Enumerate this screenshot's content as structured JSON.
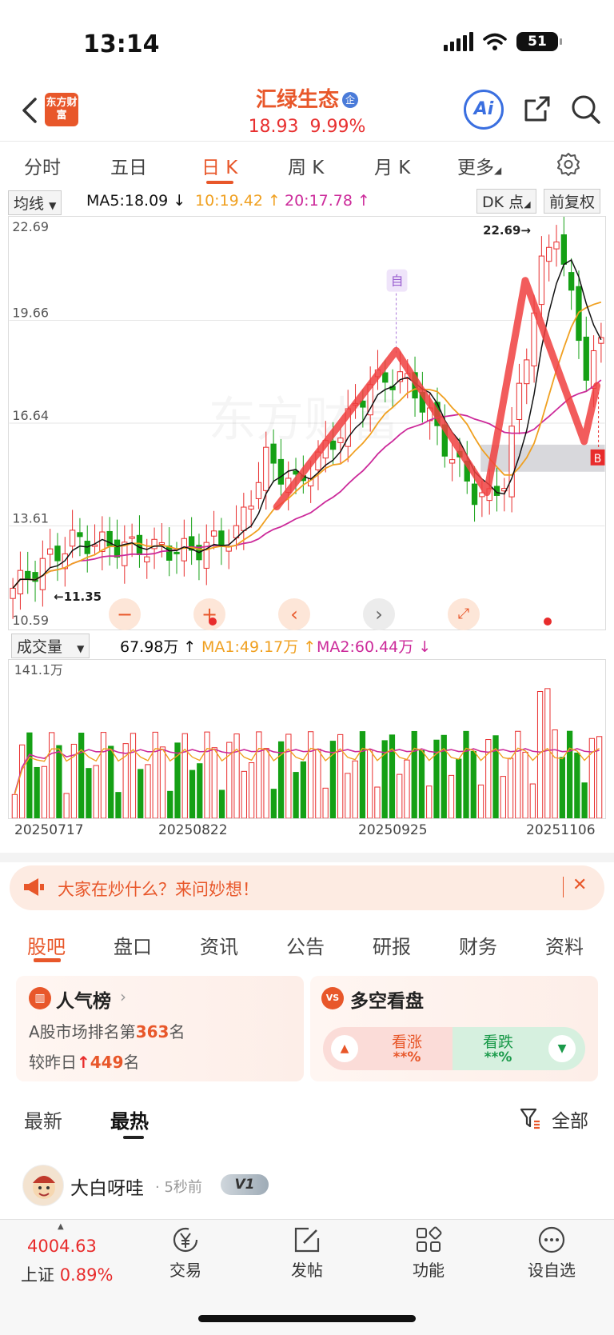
{
  "status": {
    "time": "13:14",
    "battery": "51"
  },
  "header": {
    "logo_text": "东方财富",
    "stock_name": "汇绿生态",
    "badge": "企",
    "price": "18.93",
    "change_pct": "9.99%",
    "ai_label": "Ai"
  },
  "period_tabs": [
    "分时",
    "五日",
    "日 K",
    "周 K",
    "月 K",
    "更多"
  ],
  "indicator": {
    "main_select": "均线",
    "ma5": "MA5:18.09 ↓",
    "ma10": "10:19.42 ↑",
    "ma20": "20:17.78 ↑",
    "dk": "DK 点",
    "adjust": "前复权"
  },
  "price_axis": [
    "22.69",
    "19.66",
    "16.64",
    "13.61",
    "10.59"
  ],
  "annotations": {
    "high": "22.69→",
    "low": "←11.35",
    "self_marker": "自",
    "b_marker": "B"
  },
  "volume": {
    "select": "成交量",
    "value": "67.98万 ↑",
    "ma1": "MA1:49.17万 ↑",
    "ma2": "MA2:60.44万 ↓",
    "axis_max": "141.1万"
  },
  "dates": [
    "20250717",
    "20250822",
    "20250925",
    "20251106"
  ],
  "colors": {
    "up": "#e82c2c",
    "down": "#15a015",
    "ma5": "#111111",
    "ma10": "#f0a020",
    "ma20": "#cc2a9a",
    "accent": "#e8572a"
  },
  "banner": {
    "text": "大家在炒什么？来问妙想！"
  },
  "content_tabs": [
    "股吧",
    "盘口",
    "资讯",
    "公告",
    "研报",
    "财务",
    "资料"
  ],
  "popularity": {
    "title": "人气榜",
    "rank_prefix": "A股市场排名第",
    "rank": "363",
    "rank_suffix": "名",
    "change_prefix": "较昨日",
    "change": "449",
    "change_suffix": "名"
  },
  "sentiment": {
    "title": "多空看盘",
    "icon_text": "VS",
    "rise_label": "看涨",
    "rise_value": "**%",
    "fall_label": "看跌",
    "fall_value": "**%"
  },
  "feed": {
    "tabs": [
      "最新",
      "最热"
    ],
    "filter": "全部",
    "post_user": "大白呀哇",
    "post_time": "· 5秒前",
    "level": "V1"
  },
  "bottom_bar": {
    "index_value": "4004.63",
    "index_name": "上证",
    "index_change": "0.89%",
    "items": [
      "交易",
      "发帖",
      "功能",
      "设自选"
    ]
  }
}
